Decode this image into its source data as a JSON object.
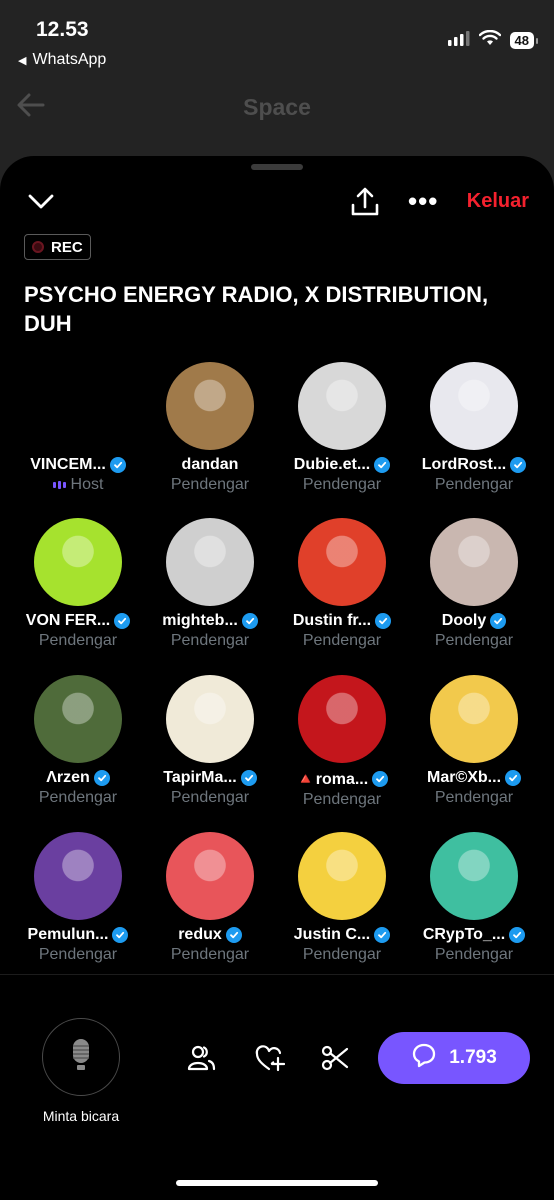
{
  "status_bar": {
    "time": "12.53",
    "back_app": "WhatsApp",
    "battery": "48"
  },
  "header": {
    "title": "Space"
  },
  "space": {
    "leave_label": "Keluar",
    "rec_label": "REC",
    "title": "PSYCHO ENERGY RADIO,  X DISTRIBUTION, DUH"
  },
  "participants": [
    {
      "name": "VINCEM...",
      "role": "Host",
      "verified": true,
      "color": "#000000"
    },
    {
      "name": "dandan",
      "role": "Pendengar",
      "verified": false,
      "color": "#a07a4a"
    },
    {
      "name": "Dubie.et...",
      "role": "Pendengar",
      "verified": true,
      "color": "#d8d8d8"
    },
    {
      "name": "LordRost...",
      "role": "Pendengar",
      "verified": true,
      "color": "#e8e8ee"
    },
    {
      "name": "VON FER...",
      "role": "Pendengar",
      "verified": true,
      "color": "#a6e22e"
    },
    {
      "name": "mighteb...",
      "role": "Pendengar",
      "verified": true,
      "color": "#cfcfcf"
    },
    {
      "name": "Dustin fr...",
      "role": "Pendengar",
      "verified": true,
      "color": "#e0402a"
    },
    {
      "name": "Dooly",
      "role": "Pendengar",
      "verified": true,
      "color": "#c9b7b0"
    },
    {
      "name": "Λrzen",
      "role": "Pendengar",
      "verified": true,
      "color": "#4f6b3a"
    },
    {
      "name": "TapirMa...",
      "role": "Pendengar",
      "verified": true,
      "color": "#f0ead8"
    },
    {
      "name": "🔺roma...",
      "role": "Pendengar",
      "verified": true,
      "color": "#c4161c"
    },
    {
      "name": "Mar©Xb...",
      "role": "Pendengar",
      "verified": true,
      "color": "#f2c94c"
    },
    {
      "name": "Pemulun...",
      "role": "Pendengar",
      "verified": true,
      "color": "#6a3fa0"
    },
    {
      "name": "redux",
      "role": "Pendengar",
      "verified": true,
      "color": "#e8555a"
    },
    {
      "name": "Justin C...",
      "role": "Pendengar",
      "verified": true,
      "color": "#f4d03f"
    },
    {
      "name": "CRypTo_...",
      "role": "Pendengar",
      "verified": true,
      "color": "#3fbfa0"
    }
  ],
  "bottom": {
    "mic_label": "Minta bicara",
    "comment_count": "1.793"
  }
}
